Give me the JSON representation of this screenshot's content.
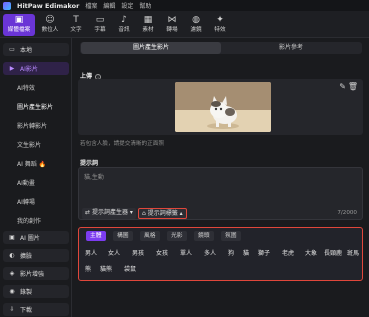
{
  "titlebar": {
    "app_name": "HitPaw Edimakor",
    "menu": [
      "檔案",
      "編輯",
      "設定",
      "幫助"
    ]
  },
  "toolbar": {
    "items": [
      {
        "label": "媒體檔案",
        "icon": "media-icon"
      },
      {
        "label": "數位人",
        "icon": "avatar-icon"
      },
      {
        "label": "文字",
        "icon": "text-icon"
      },
      {
        "label": "字幕",
        "icon": "subtitle-icon"
      },
      {
        "label": "音訊",
        "icon": "audio-icon"
      },
      {
        "label": "素材",
        "icon": "stock-icon"
      },
      {
        "label": "轉場",
        "icon": "transition-icon"
      },
      {
        "label": "濾鏡",
        "icon": "filter-icon"
      },
      {
        "label": "特效",
        "icon": "effects-icon"
      }
    ]
  },
  "sidebar": {
    "items": [
      {
        "label": "本地",
        "icon": "folder-icon"
      },
      {
        "label": "AI影片",
        "icon": "ai-video-icon"
      },
      {
        "label": "AI 圖片",
        "icon": "ai-image-icon"
      },
      {
        "label": "擴臉",
        "icon": "face-icon"
      },
      {
        "label": "影片增強",
        "icon": "enhance-icon"
      },
      {
        "label": "錄製",
        "icon": "record-icon"
      },
      {
        "label": "下載",
        "icon": "download-icon"
      }
    ],
    "sub_items": [
      "AI特效",
      "圖片產生影片",
      "影片轉影片",
      "文生影片",
      "AI 舞蹈",
      "AI動畫",
      "AI轉場",
      "我的創作"
    ]
  },
  "main": {
    "tabs": [
      "圖片產生影片",
      "影片參考"
    ],
    "upload_label": "上傳",
    "upload_hint": "若包含人臉，請提交清晰的正面照",
    "prompt_label": "提示詞",
    "prompt_placeholder": "貓,生動",
    "counter": "7/2000",
    "generator_button": "提示詞產生器",
    "tags_button": "提示詞標籤",
    "categories": [
      "主體",
      "構圖",
      "風格",
      "光影",
      "鏡頭",
      "氛圍"
    ],
    "tags_row1": [
      "男人",
      "女人",
      "男孩",
      "女孩",
      "單人",
      "多人",
      "狗",
      "貓",
      "獅子",
      "老虎",
      "大象",
      "長頸鹿",
      "斑馬"
    ],
    "tags_row2": [
      "熊",
      "貓熊",
      "袋鼠"
    ]
  },
  "colors": {
    "accent": "#7c3cf0",
    "highlight_border": "#e0473b",
    "background": "#1a1b1e"
  }
}
